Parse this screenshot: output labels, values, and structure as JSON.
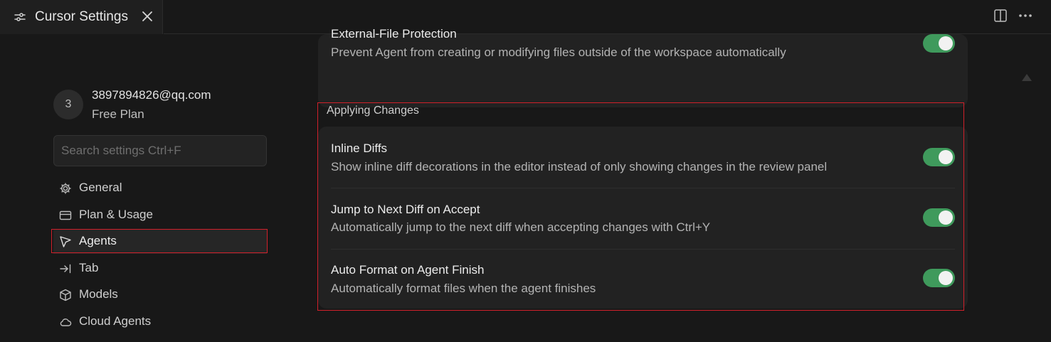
{
  "tab": {
    "title": "Cursor Settings"
  },
  "account": {
    "avatar_initial": "3",
    "email": "3897894826@qq.com",
    "plan": "Free Plan"
  },
  "search": {
    "placeholder": "Search settings Ctrl+F"
  },
  "sidebar": {
    "items": [
      {
        "label": "General",
        "icon": "gear-icon"
      },
      {
        "label": "Plan & Usage",
        "icon": "card-icon"
      },
      {
        "label": "Agents",
        "icon": "agent-icon",
        "active": true
      },
      {
        "label": "Tab",
        "icon": "tab-arrow-icon"
      },
      {
        "label": "Models",
        "icon": "cube-icon"
      },
      {
        "label": "Cloud Agents",
        "icon": "cloud-icon"
      }
    ]
  },
  "main": {
    "top_setting": {
      "title": "External-File Protection",
      "description": "Prevent Agent from creating or modifying files outside of the workspace automatically",
      "enabled": true
    },
    "applying_changes": {
      "section_label": "Applying Changes",
      "settings": [
        {
          "title": "Inline Diffs",
          "description": "Show inline diff decorations in the editor instead of only showing changes in the review panel",
          "enabled": true
        },
        {
          "title": "Jump to Next Diff on Accept",
          "description": "Automatically jump to the next diff when accepting changes with Ctrl+Y",
          "enabled": true
        },
        {
          "title": "Auto Format on Agent Finish",
          "description": "Automatically format files when the agent finishes",
          "enabled": true
        }
      ]
    }
  },
  "colors": {
    "background": "#181818",
    "card": "#222222",
    "toggle_on": "#3f9a5c",
    "highlight_border": "#d0202a"
  }
}
